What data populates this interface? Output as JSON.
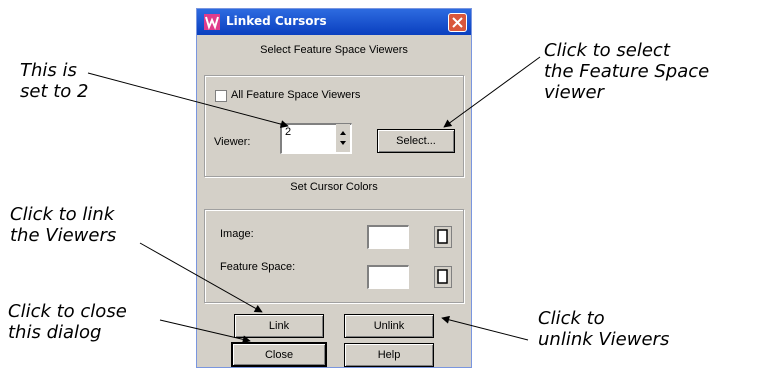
{
  "dialog": {
    "title": "Linked Cursors",
    "section_select": "Select Feature Space Viewers",
    "all_viewers_label": "All Feature Space Viewers",
    "viewer_label": "Viewer:",
    "viewer_value": "2",
    "select_button": "Select...",
    "section_colors": "Set Cursor Colors",
    "image_label": "Image:",
    "feature_space_label": "Feature Space:",
    "link_button": "Link",
    "unlink_button": "Unlink",
    "close_button": "Close",
    "help_button": "Help"
  },
  "annotations": {
    "set_to_2": "This is\nset to 2",
    "select_viewer": "Click to select\nthe Feature Space\nviewer",
    "link_viewers": "Click to link\nthe Viewers",
    "close_dialog": "Click to close\nthis dialog",
    "unlink_viewers": "Click to\nunlink Viewers"
  },
  "colors": {
    "title_bar": "#0a3fbf",
    "dialog_bg": "#d4d0c8",
    "close_button": "#d9573b"
  }
}
